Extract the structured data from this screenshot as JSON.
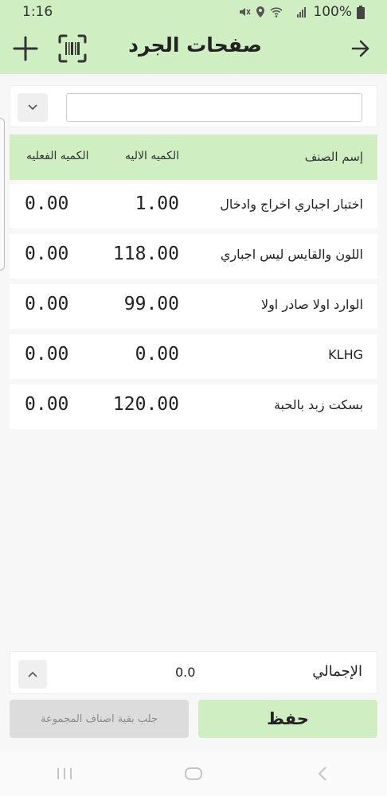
{
  "status": {
    "time": "1:16",
    "battery": "100%"
  },
  "appbar": {
    "title": "صفحات الجرد",
    "icons": [
      "plus-icon",
      "barcode-scan-icon",
      "arrow-right-icon"
    ]
  },
  "filter": {
    "input_value": ""
  },
  "table": {
    "headers": {
      "name": "إسم الصنف",
      "auto_qty": "الكميه الاليه",
      "actual_qty": "الكميه الفعليه"
    },
    "rows": [
      {
        "name": "اختبار اجباري اخراج وادخال",
        "auto_qty": "1.00",
        "actual_qty": "0.00"
      },
      {
        "name": "اللون والقايس ليس اجباري",
        "auto_qty": "118.00",
        "actual_qty": "0.00"
      },
      {
        "name": "الوارد اولا صادر اولا",
        "auto_qty": "99.00",
        "actual_qty": "0.00"
      },
      {
        "name": "KLHG",
        "auto_qty": "0.00",
        "actual_qty": "0.00"
      },
      {
        "name": "بسكت زبد بالحبة",
        "auto_qty": "120.00",
        "actual_qty": "0.00"
      }
    ]
  },
  "footer": {
    "total_label": "الإجمالي",
    "total_value": "0.0",
    "save_label": "حفظ",
    "fetch_label": "جلب بقية اصناف المجموعة"
  },
  "colors": {
    "accent": "#cfeec2",
    "disabled": "#dcdcdc"
  }
}
